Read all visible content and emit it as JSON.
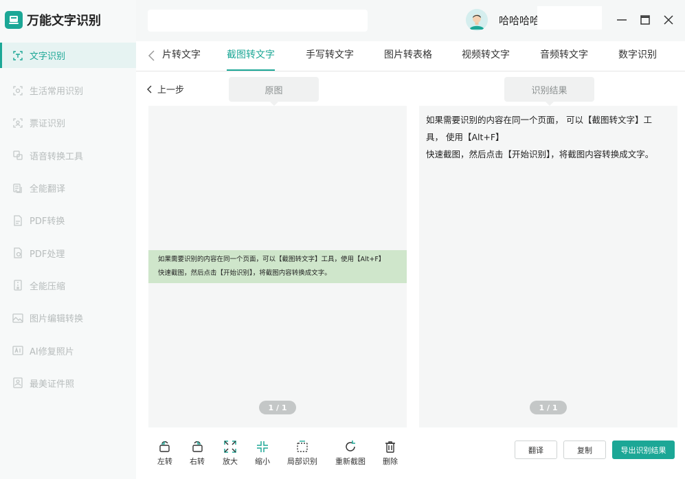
{
  "app": {
    "title": "万能文字识别",
    "accent": "#1ca796"
  },
  "sidebar": {
    "items": [
      {
        "label": "文字识别",
        "icon": "text-scan-icon",
        "active": true
      },
      {
        "label": "生活常用识别",
        "icon": "scan-frame-icon"
      },
      {
        "label": "票证识别",
        "icon": "id-scan-icon"
      },
      {
        "label": "语音转换工具",
        "icon": "voice-convert-icon"
      },
      {
        "label": "全能翻译",
        "icon": "translate-icon"
      },
      {
        "label": "PDF转换",
        "icon": "pdf-convert-icon"
      },
      {
        "label": "PDF处理",
        "icon": "pdf-process-icon"
      },
      {
        "label": "全能压缩",
        "icon": "compress-icon"
      },
      {
        "label": "图片编辑转换",
        "icon": "image-edit-icon"
      },
      {
        "label": "AI修复照片",
        "icon": "ai-repair-icon"
      },
      {
        "label": "最美证件照",
        "icon": "id-photo-icon"
      }
    ]
  },
  "header": {
    "username": "哈哈哈哈"
  },
  "tabs": [
    {
      "label": "片转文字"
    },
    {
      "label": "截图转文字",
      "active": true
    },
    {
      "label": "手写转文字"
    },
    {
      "label": "图片转表格"
    },
    {
      "label": "视频转文字"
    },
    {
      "label": "音频转文字"
    },
    {
      "label": "数字识别"
    }
  ],
  "content": {
    "back_label": "上一步",
    "original_label": "原图",
    "result_label": "识别结果",
    "snip_line1": "如果需要识别的内容在同一个页面，可以【截图转文字】工具，使用【Alt+F】",
    "snip_line2": "快速截图，然后点击【开始识别】，将截图内容转换成文字。",
    "result_line1": "如果需要识别的内容在同一个页面， 可以【截图转文字】工",
    "result_line2": "具， 使用【Alt+F】",
    "result_line3": "快速截图，然后点击【开始识别】，将截图内容转换成文字。",
    "left_page": "1 / 1",
    "right_page": "1 / 1"
  },
  "toolbar": {
    "rotate_left": "左转",
    "rotate_right": "右转",
    "zoom_in": "放大",
    "zoom_out": "缩小",
    "partial": "局部识别",
    "recapture": "重新截图",
    "delete": "删除"
  },
  "actions": {
    "translate": "翻译",
    "copy": "复制",
    "export": "导出识别结果"
  }
}
